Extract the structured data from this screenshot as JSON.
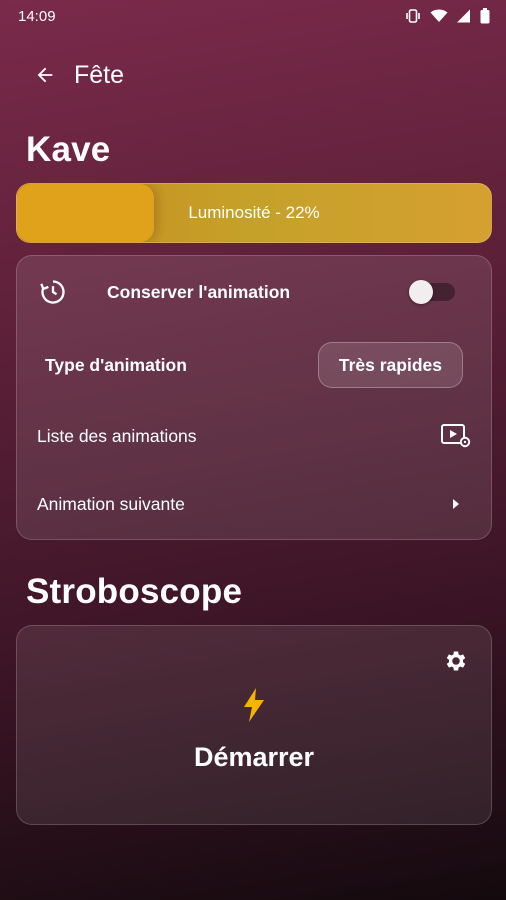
{
  "status_bar": {
    "time": "14:09",
    "icons": [
      "vibrate-icon",
      "wifi-icon",
      "signal-icon",
      "battery-icon"
    ]
  },
  "app_bar": {
    "back_icon": "arrow-left-icon",
    "title": "Fête"
  },
  "group": {
    "title": "Kave",
    "brightness_label": "Luminosité - 22%",
    "brightness_value": 0.22,
    "brightness_color": "#e0a21a"
  },
  "animation_card": {
    "keep_animation": {
      "icon": "history-icon",
      "label": "Conserver l'animation",
      "enabled": false
    },
    "animation_type": {
      "label": "Type d'animation",
      "value": "Très rapides"
    },
    "animation_list": {
      "label": "Liste des animations",
      "icon": "video-settings-icon"
    },
    "next_animation": {
      "label": "Animation suivante",
      "icon": "chevron-right-icon"
    }
  },
  "strobe": {
    "title": "Stroboscope",
    "settings_icon": "gear-icon",
    "start_icon": "lightning-icon",
    "start_label": "Démarrer",
    "accent": "#f5b400"
  }
}
